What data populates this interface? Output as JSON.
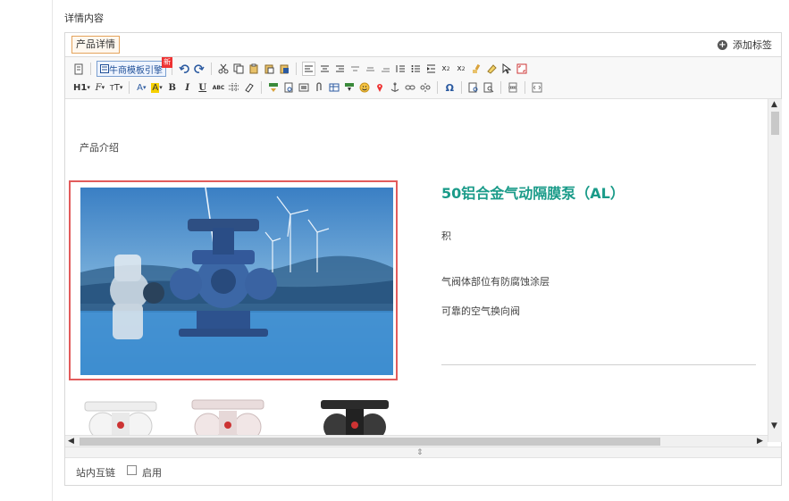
{
  "section_title": "详情内容",
  "tabs": {
    "active": "产品详情",
    "add_tag": "添加标签"
  },
  "toolbar": {
    "row1": [
      "source",
      "template",
      "undo",
      "redo",
      "cut",
      "copy",
      "paste",
      "paste-text",
      "paste-word",
      "align-left",
      "align-center",
      "align-right",
      "justify",
      "indent-center",
      "indent-right",
      "ordered-list",
      "unordered-list",
      "indent",
      "subscript",
      "superscript",
      "format-brush",
      "clear-format",
      "select",
      "fullscreen"
    ],
    "template_label": "牛商模板引擎",
    "template_badge": "新",
    "heading_label": "H1",
    "font_family_label": "F",
    "font_size_label": "T",
    "font_color_label": "A",
    "bg_color_label": "A",
    "bold_label": "B",
    "italic_label": "I",
    "underline_label": "U",
    "strike_label": "ABC"
  },
  "content": {
    "intro": "产品介绍",
    "product_title": "50铝合金气动隔膜泵（AL）",
    "features": [
      "积",
      "气阀体部位有防腐蚀涂层",
      "可靠的空气换向阀"
    ]
  },
  "footer": {
    "link_label": "站内互链",
    "enable_label": "启用"
  },
  "colors": {
    "title": "#1a9b89",
    "tab_border": "#e4a35b",
    "photo_border": "#e25b5b"
  }
}
